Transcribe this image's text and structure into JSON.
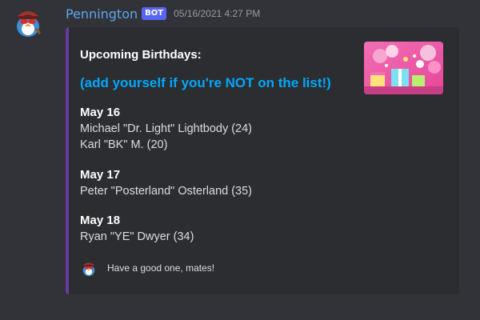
{
  "message": {
    "author": "Pennington",
    "badge": "BOT",
    "timestamp": "05/16/2021 4:27 PM",
    "avatar_icon": "penguin-mascot-icon"
  },
  "embed": {
    "accent_color": "#6b3aa0",
    "title": "Upcoming Birthdays:",
    "subtitle": "(add yourself if you're NOT on the list!)",
    "thumbnail_icon": "birthday-party-image",
    "groups": [
      {
        "date": "May 16",
        "people": [
          "Michael \"Dr. Light\" Lightbody (24)",
          "Karl \"BK\" M. (20)"
        ]
      },
      {
        "date": "May 17",
        "people": [
          "Peter \"Posterland\" Osterland (35)"
        ]
      },
      {
        "date": "May 18",
        "people": [
          "Ryan \"YE\" Dwyer (34)"
        ]
      }
    ],
    "footer": {
      "icon": "penguin-mascot-icon",
      "text": "Have a good one, mates!"
    }
  },
  "colors": {
    "background": "#313338",
    "embed_background": "#2b2d31",
    "username": "#5ea6ee",
    "link_blue": "#00a8fc",
    "bot_badge": "#5865f2"
  }
}
